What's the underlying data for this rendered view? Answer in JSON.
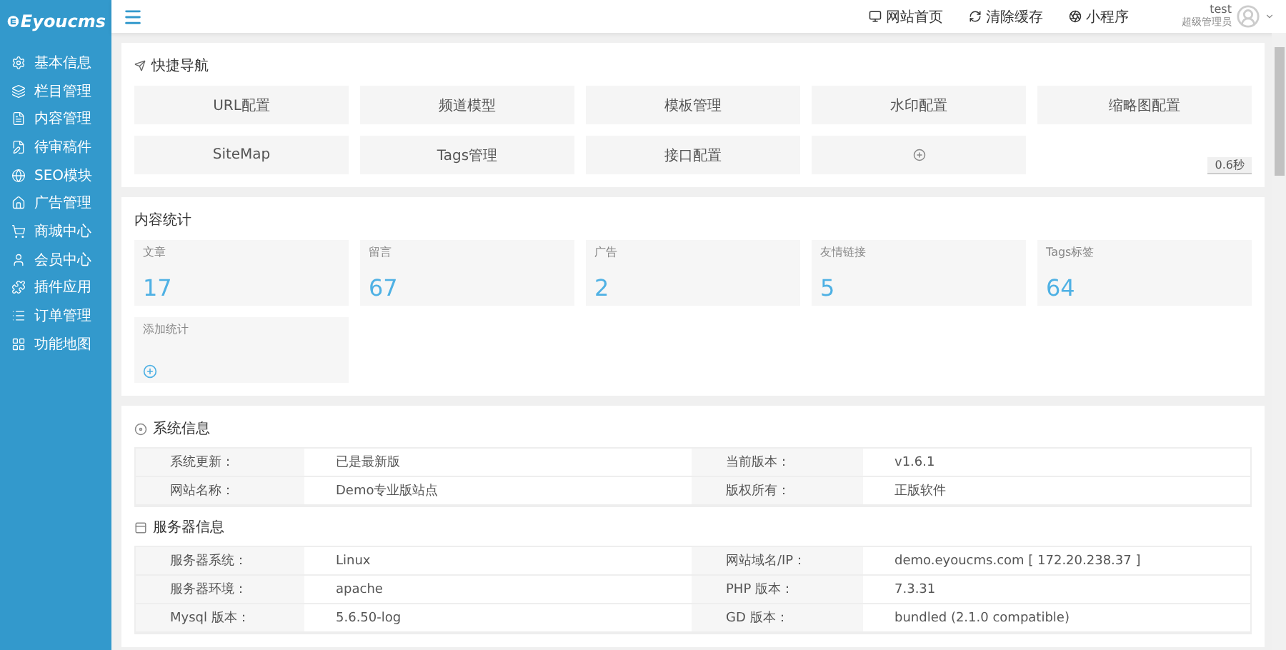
{
  "sidebar": {
    "logo": "Eyoucms",
    "items": [
      {
        "label": "基本信息"
      },
      {
        "label": "栏目管理"
      },
      {
        "label": "内容管理"
      },
      {
        "label": "待审稿件"
      },
      {
        "label": "SEO模块"
      },
      {
        "label": "广告管理"
      },
      {
        "label": "商城中心"
      },
      {
        "label": "会员中心"
      },
      {
        "label": "插件应用"
      },
      {
        "label": "订单管理"
      },
      {
        "label": "功能地图"
      }
    ]
  },
  "header": {
    "links": [
      {
        "label": "网站首页"
      },
      {
        "label": "清除缓存"
      },
      {
        "label": "小程序"
      }
    ],
    "user": {
      "name": "test",
      "role": "超级管理员"
    }
  },
  "quick_nav": {
    "title": "快捷导航",
    "items": [
      {
        "kind": "link",
        "label": "URL配置"
      },
      {
        "kind": "link",
        "label": "频道模型"
      },
      {
        "kind": "link",
        "label": "模板管理"
      },
      {
        "kind": "link",
        "label": "水印配置"
      },
      {
        "kind": "link",
        "label": "缩略图配置"
      },
      {
        "kind": "link",
        "label": "SiteMap"
      },
      {
        "kind": "link",
        "label": "Tags管理"
      },
      {
        "kind": "link",
        "label": "接口配置"
      },
      {
        "kind": "add"
      }
    ],
    "timer": "0.6秒"
  },
  "stats": {
    "title": "内容统计",
    "items": [
      {
        "kind": "stat",
        "label": "文章",
        "value": "17"
      },
      {
        "kind": "stat",
        "label": "留言",
        "value": "67"
      },
      {
        "kind": "stat",
        "label": "广告",
        "value": "2"
      },
      {
        "kind": "stat",
        "label": "友情链接",
        "value": "5"
      },
      {
        "kind": "stat",
        "label": "Tags标签",
        "value": "64"
      },
      {
        "kind": "add",
        "label": "添加统计"
      }
    ]
  },
  "system_info": {
    "title": "系统信息",
    "rows": [
      [
        "系统更新：",
        "已是最新版",
        "当前版本：",
        "v1.6.1"
      ],
      [
        "网站名称：",
        "Demo专业版站点",
        "版权所有：",
        "正版软件"
      ]
    ]
  },
  "server_info": {
    "title": "服务器信息",
    "rows": [
      [
        "服务器系统：",
        "Linux",
        "网站域名/IP：",
        "demo.eyoucms.com [ 172.20.238.37 ]"
      ],
      [
        "服务器环境：",
        "apache",
        "PHP 版本：",
        "7.3.31"
      ],
      [
        "Mysql 版本：",
        "5.6.50-log",
        "GD 版本：",
        "bundled (2.1.0 compatible)"
      ]
    ]
  }
}
